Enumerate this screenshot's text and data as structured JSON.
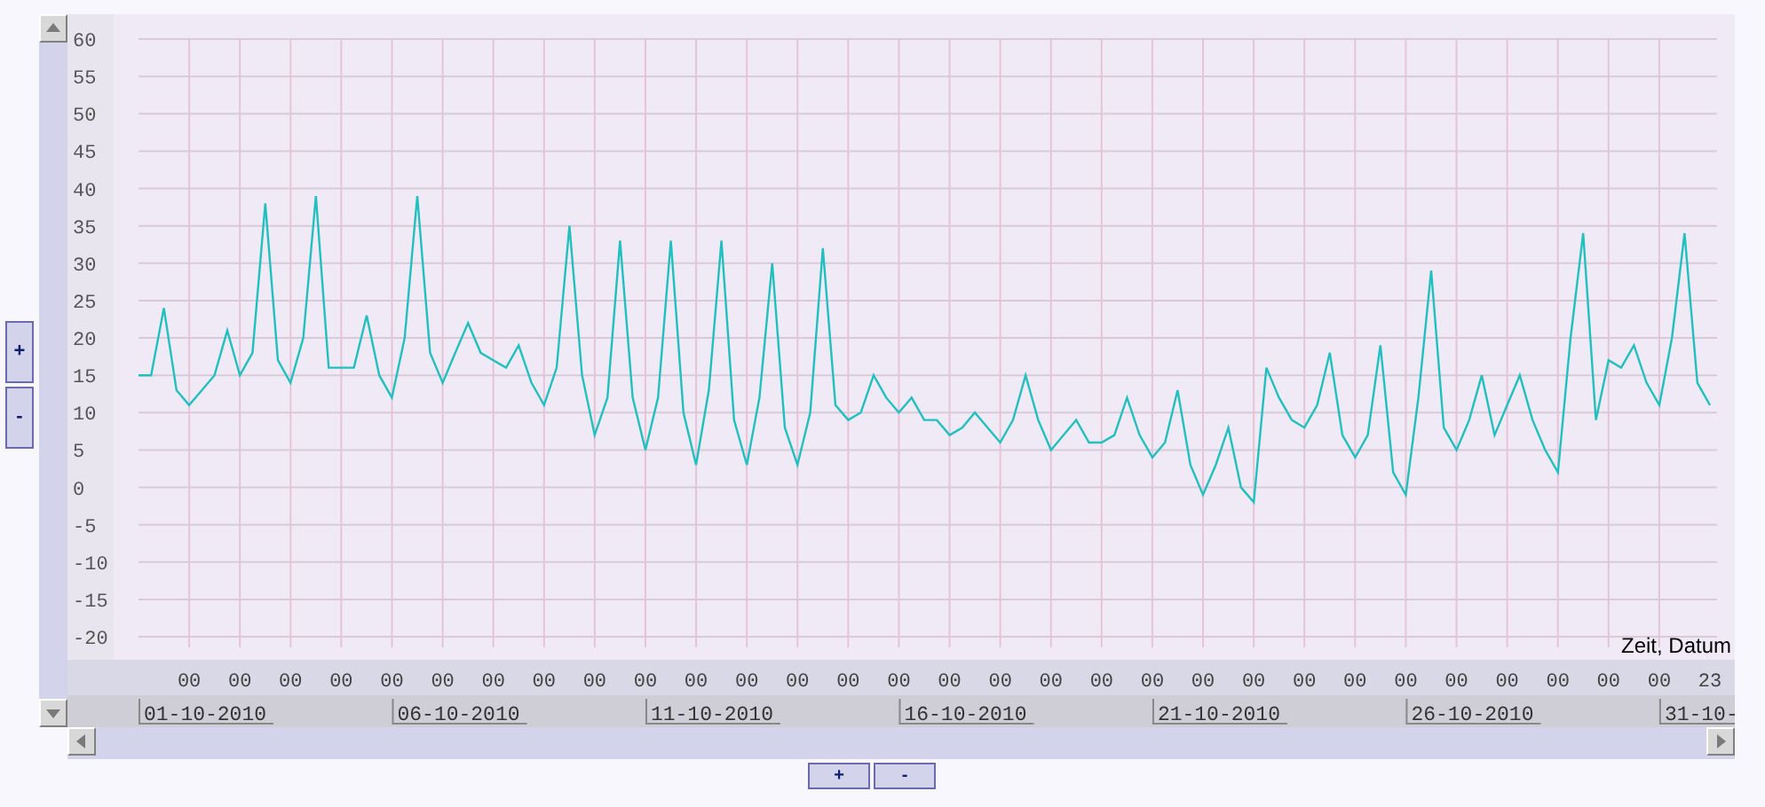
{
  "chart": {
    "chart_data": {
      "type": "line",
      "grid": true,
      "xlabel": "Zeit, Datum",
      "ylim": [
        -20,
        60
      ],
      "yticks": [
        60,
        55,
        50,
        45,
        40,
        35,
        30,
        25,
        20,
        15,
        10,
        5,
        0,
        -5,
        -10,
        -15,
        -20
      ],
      "categories": [
        null,
        null,
        null,
        null,
        "00",
        null,
        null,
        null,
        "00",
        null,
        null,
        null,
        "00",
        null,
        null,
        null,
        "00",
        null,
        null,
        null,
        "00",
        null,
        null,
        null,
        "00",
        null,
        null,
        null,
        "00",
        null,
        null,
        null,
        "00",
        null,
        null,
        null,
        "00",
        null,
        null,
        null,
        "00",
        null,
        null,
        null,
        "00",
        null,
        null,
        null,
        "00",
        null,
        null,
        null,
        "00",
        null,
        null,
        null,
        "00",
        null,
        null,
        null,
        "00",
        null,
        null,
        null,
        "00",
        null,
        null,
        null,
        "00",
        null,
        null,
        null,
        "00",
        null,
        null,
        null,
        "00",
        null,
        null,
        null,
        "00",
        null,
        null,
        null,
        "00",
        null,
        null,
        null,
        "00",
        null,
        null,
        null,
        "00",
        null,
        null,
        null,
        "00",
        null,
        null,
        null,
        "00",
        null,
        null,
        null,
        "00",
        null,
        null,
        null,
        "00",
        null,
        null,
        null,
        "00",
        null,
        null,
        null,
        "00",
        null,
        null,
        null,
        "00",
        null,
        null,
        null,
        "23"
      ],
      "series": [
        {
          "color": "#20c0c0",
          "values": [
            15,
            15,
            24,
            13,
            11,
            13,
            15,
            21,
            15,
            18,
            38,
            17,
            14,
            20,
            39,
            16,
            16,
            16,
            23,
            15,
            12,
            20,
            39,
            18,
            14,
            18,
            22,
            18,
            17,
            16,
            19,
            14,
            11,
            16,
            35,
            15,
            7,
            12,
            33,
            12,
            5,
            12,
            33,
            10,
            3,
            13,
            33,
            9,
            3,
            12,
            30,
            8,
            3,
            10,
            32,
            11,
            9,
            10,
            15,
            12,
            10,
            12,
            9,
            9,
            7,
            8,
            10,
            8,
            6,
            9,
            15,
            9,
            5,
            7,
            9,
            6,
            6,
            7,
            12,
            7,
            4,
            6,
            13,
            3,
            -1,
            3,
            8,
            0,
            -2,
            16,
            12,
            9,
            8,
            11,
            18,
            7,
            4,
            7,
            19,
            2,
            -1,
            12,
            29,
            8,
            5,
            9,
            15,
            7,
            11,
            15,
            9,
            5,
            2,
            20,
            34,
            9,
            17,
            16,
            19,
            14,
            11,
            20,
            34,
            14,
            11
          ]
        }
      ]
    },
    "date_labels": [
      "01-10-2010",
      "06-10-2010",
      "11-10-2010",
      "16-10-2010",
      "21-10-2010",
      "26-10-2010",
      "31-10-"
    ]
  },
  "zoom_buttons_left": [
    "+",
    "-"
  ],
  "zoom_buttons_bottom": [
    "+",
    "-"
  ]
}
